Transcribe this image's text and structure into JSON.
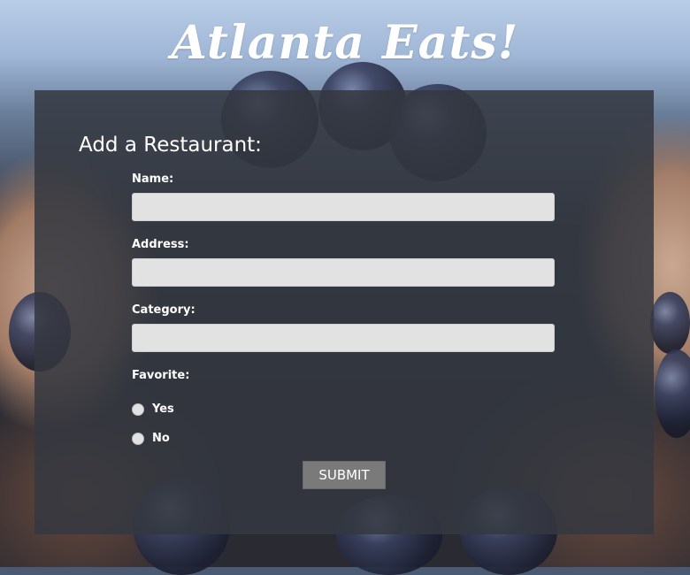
{
  "header": {
    "title": "Atlanta Eats!"
  },
  "form": {
    "heading": "Add a Restaurant:",
    "fields": [
      {
        "label": "Name:",
        "value": ""
      },
      {
        "label": "Address:",
        "value": ""
      },
      {
        "label": "Category:",
        "value": ""
      }
    ],
    "favorite": {
      "label": "Favorite:",
      "options": [
        {
          "label": "Yes",
          "selected": false
        },
        {
          "label": "No",
          "selected": false
        }
      ]
    },
    "submit_label": "SUBMIT"
  },
  "colors": {
    "panel": "#343840",
    "input": "#f5f5f5",
    "submit": "#7a7a7a",
    "text": "#ffffff"
  }
}
